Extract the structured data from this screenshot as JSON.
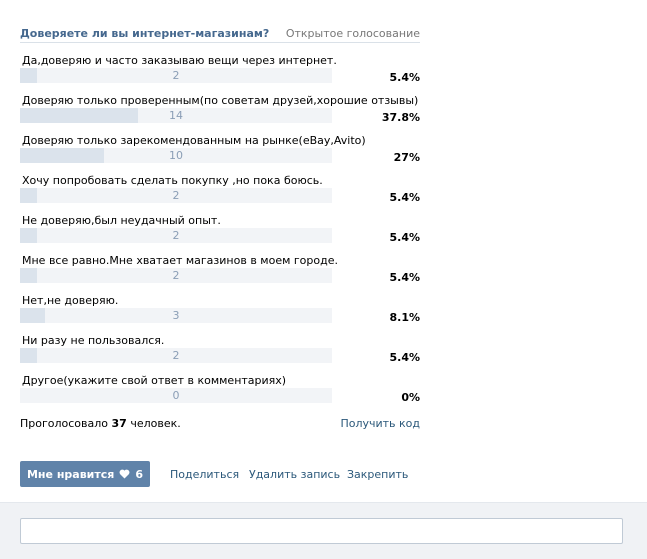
{
  "poll": {
    "title": "Доверяете ли вы интернет-магазинам?",
    "type_label": "Открытое голосование",
    "options": [
      {
        "label": "Да,доверяю и часто заказываю вещи через интернет.",
        "count": "2",
        "percent": "5.4%",
        "fraction": 0.054
      },
      {
        "label": "Доверяю только проверенным(по советам друзей,хорошие отзывы)",
        "count": "14",
        "percent": "37.8%",
        "fraction": 0.378
      },
      {
        "label": "Доверяю только зарекомендованным на рынке(eBay,Avito)",
        "count": "10",
        "percent": "27%",
        "fraction": 0.27
      },
      {
        "label": "Хочу попробовать сделать покупку ,но пока боюсь.",
        "count": "2",
        "percent": "5.4%",
        "fraction": 0.054
      },
      {
        "label": "Не доверяю,был неудачный опыт.",
        "count": "2",
        "percent": "5.4%",
        "fraction": 0.054
      },
      {
        "label": "Мне все равно.Мне хватает магазинов в моем городе.",
        "count": "2",
        "percent": "5.4%",
        "fraction": 0.054
      },
      {
        "label": "Нет,не доверяю.",
        "count": "3",
        "percent": "8.1%",
        "fraction": 0.081
      },
      {
        "label": "Ни разу не пользовался.",
        "count": "2",
        "percent": "5.4%",
        "fraction": 0.054
      },
      {
        "label": "Другое(укажите свой ответ в комментариях)",
        "count": "0",
        "percent": "0%",
        "fraction": 0
      }
    ],
    "voted_prefix": "Проголосовало",
    "voted_count": "37",
    "voted_suffix": "человек.",
    "get_code_label": "Получить код"
  },
  "actions": {
    "like_label": "Мне нравится",
    "like_count": "6",
    "like_icon": "heart-icon",
    "share_label": "Поделиться",
    "delete_label": "Удалить запись",
    "pin_label": "Закрепить"
  },
  "comment": {
    "placeholder": ""
  },
  "colors": {
    "title": "#45688e",
    "link": "#2b587a",
    "bar_bg": "#f2f4f7",
    "bar_fill": "#dbe3ec",
    "bar_count": "#8b9eb6",
    "like_button": "#6083a9"
  }
}
